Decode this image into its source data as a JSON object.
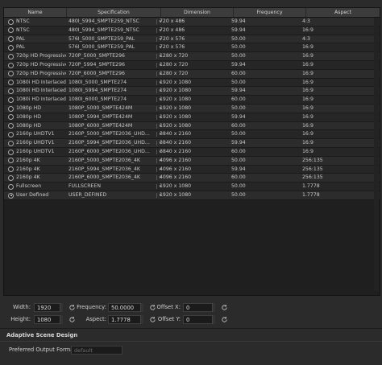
{
  "table": {
    "columns": [
      "Name",
      "Specification",
      "Dimension",
      "Frequency",
      "Aspect"
    ],
    "rows": [
      {
        "name": "NTSC",
        "spec": "480I_5994_SMPTE259_NTSC",
        "dim": "720 x 486",
        "freq": "59.94",
        "aspect": "4:3",
        "selected": false
      },
      {
        "name": "NTSC",
        "spec": "480I_5994_SMPTE259_NTSC",
        "dim": "720 x 486",
        "freq": "59.94",
        "aspect": "16:9",
        "selected": false
      },
      {
        "name": "PAL",
        "spec": "576I_5000_SMPTE259_PAL",
        "dim": "720 x 576",
        "freq": "50.00",
        "aspect": "4:3",
        "selected": false
      },
      {
        "name": "PAL",
        "spec": "576I_5000_SMPTE259_PAL",
        "dim": "720 x 576",
        "freq": "50.00",
        "aspect": "16:9",
        "selected": false
      },
      {
        "name": "720p HD Progressive",
        "spec": "720P_5000_SMPTE296",
        "dim": "1280 x 720",
        "freq": "50.00",
        "aspect": "16:9",
        "selected": false
      },
      {
        "name": "720p HD Progressive",
        "spec": "720P_5994_SMPTE296",
        "dim": "1280 x 720",
        "freq": "59.94",
        "aspect": "16:9",
        "selected": false
      },
      {
        "name": "720p HD Progressive",
        "spec": "720P_6000_SMPTE296",
        "dim": "1280 x 720",
        "freq": "60.00",
        "aspect": "16:9",
        "selected": false
      },
      {
        "name": "1080i HD Interlaced",
        "spec": "1080I_5000_SMPTE274",
        "dim": "1920 x 1080",
        "freq": "50.00",
        "aspect": "16:9",
        "selected": false
      },
      {
        "name": "1080i HD Interlaced",
        "spec": "1080I_5994_SMPTE274",
        "dim": "1920 x 1080",
        "freq": "59.94",
        "aspect": "16:9",
        "selected": false
      },
      {
        "name": "1080i HD Interlaced",
        "spec": "1080I_6000_SMPTE274",
        "dim": "1920 x 1080",
        "freq": "60.00",
        "aspect": "16:9",
        "selected": false
      },
      {
        "name": "1080p HD",
        "spec": "1080P_5000_SMPTE424M",
        "dim": "1920 x 1080",
        "freq": "50.00",
        "aspect": "16:9",
        "selected": false
      },
      {
        "name": "1080p HD",
        "spec": "1080P_5994_SMPTE424M",
        "dim": "1920 x 1080",
        "freq": "59.94",
        "aspect": "16:9",
        "selected": false
      },
      {
        "name": "1080p HD",
        "spec": "1080P_6000_SMPTE424M",
        "dim": "1920 x 1080",
        "freq": "60.00",
        "aspect": "16:9",
        "selected": false
      },
      {
        "name": "2160p UHDTV1",
        "spec": "2160P_5000_SMPTE2036_UHD...",
        "dim": "3840 x 2160",
        "freq": "50.00",
        "aspect": "16:9",
        "selected": false
      },
      {
        "name": "2160p UHDTV1",
        "spec": "2160P_5994_SMPTE2036_UHD...",
        "dim": "3840 x 2160",
        "freq": "59.94",
        "aspect": "16:9",
        "selected": false
      },
      {
        "name": "2160p UHDTV1",
        "spec": "2160P_6000_SMPTE2036_UHD...",
        "dim": "3840 x 2160",
        "freq": "60.00",
        "aspect": "16:9",
        "selected": false
      },
      {
        "name": "2160p 4K",
        "spec": "2160P_5000_SMPTE2036_4K",
        "dim": "4096 x 2160",
        "freq": "50.00",
        "aspect": "256:135",
        "selected": false
      },
      {
        "name": "2160p 4K",
        "spec": "2160P_5994_SMPTE2036_4K",
        "dim": "4096 x 2160",
        "freq": "59.94",
        "aspect": "256:135",
        "selected": false
      },
      {
        "name": "2160p 4K",
        "spec": "2160P_6000_SMPTE2036_4K",
        "dim": "4096 x 2160",
        "freq": "60.00",
        "aspect": "256:135",
        "selected": false
      },
      {
        "name": "Fullscreen",
        "spec": "FULLSCREEN",
        "dim": "1920 x 1080",
        "freq": "50.00",
        "aspect": "1.7778",
        "selected": false
      },
      {
        "name": "User Defined",
        "spec": "USER_DEFINED",
        "dim": "1920 x 1080",
        "freq": "50.00",
        "aspect": "1.7778",
        "selected": true
      }
    ]
  },
  "controls": {
    "width_label": "Width:",
    "width_value": "1920",
    "height_label": "Height:",
    "height_value": "1080",
    "frequency_label": "Frequency:",
    "frequency_value": "50.0000",
    "aspect_label": "Aspect:",
    "aspect_value": "1.7778",
    "offset_x_label": "Offset X:",
    "offset_x_value": "0",
    "offset_y_label": "Offset Y:",
    "offset_y_value": "0"
  },
  "adaptive": {
    "title": "Adaptive Scene Design",
    "preferred_label": "Preferred Output Format",
    "preferred_placeholder": "default"
  },
  "icons": {
    "reset": "reset-icon",
    "radio": "radio-icon",
    "dropdown": "chevron-down-icon"
  },
  "colors": {
    "background": "#2b2b2b",
    "table_bg": "#1f1f1f",
    "header_bg": "#3c3c3c",
    "text": "#c8c8c8"
  }
}
